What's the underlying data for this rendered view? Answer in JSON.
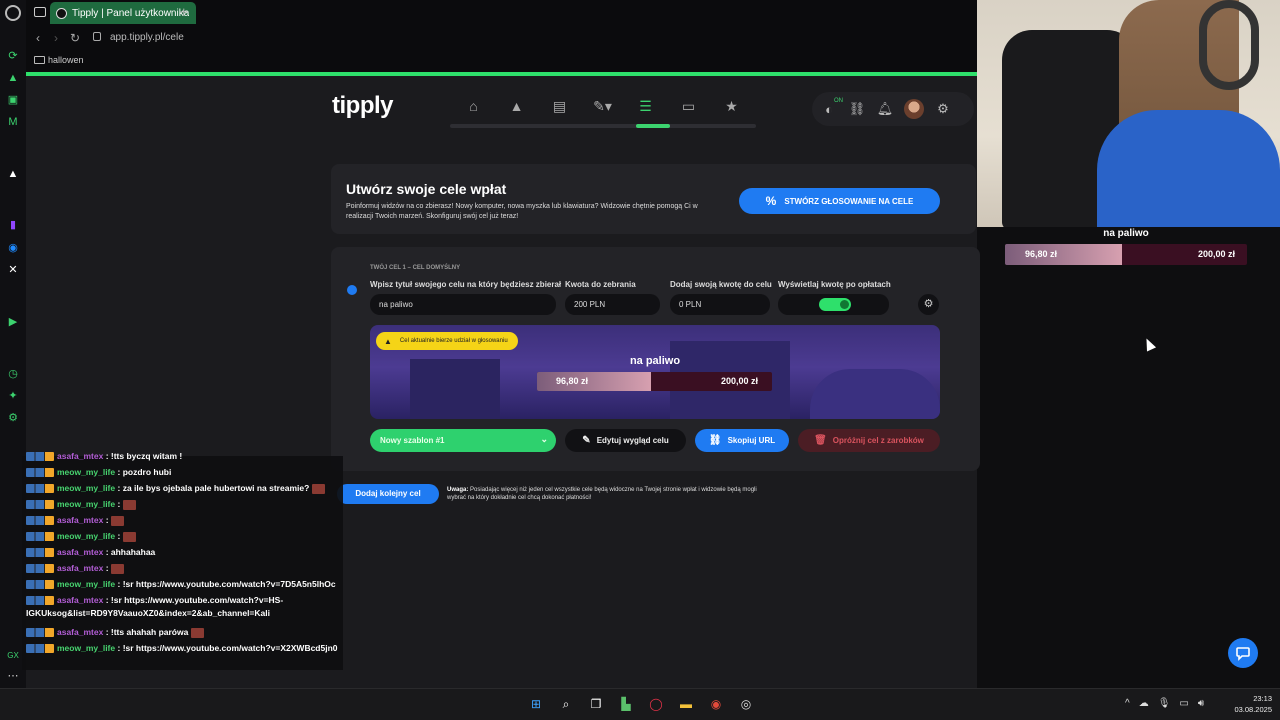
{
  "browser": {
    "tab_title": "Tipply | Panel użytkownika",
    "new_tab_symbol": "+",
    "url": "app.tipply.pl/cele",
    "bookmark": "hallowen"
  },
  "topnav": {
    "logo": "tipply",
    "on_badge": "ON"
  },
  "hero": {
    "title": "Utwórz swoje cele wpłat",
    "description": "Poinformuj widzów na co zbierasz! Nowy komputer, nowa myszka lub klawiatura? Widzowie chętnie pomogą Ci w realizacji Twoich marzeń. Skonfiguruj swój cel już teraz!",
    "button": "STWÓRZ GŁOSOWANIE NA CELE"
  },
  "goal": {
    "header": "TWÓJ CEL 1 – CEL DOMYŚLNY",
    "title_label": "Wpisz tytuł swojego celu na który będziesz zbierał",
    "title_value": "na paliwo",
    "amount_label": "Kwota do zebrania",
    "amount_value": "200 PLN",
    "own_label": "Dodaj swoją kwotę do celu",
    "own_value": "0 PLN",
    "show_label": "Wyświetlaj kwotę po opłatach",
    "toggle_on": true,
    "warning": "Cel aktualnie bierze udział w głosowaniu",
    "preview_title": "na paliwo",
    "current": "96,80 zł",
    "target": "200,00 zł",
    "progress_fraction": 0.484,
    "template_button": "Nowy szablon #1",
    "edit_button": "Edytuj wygląd celu",
    "copy_button": "Skopiuj URL",
    "clear_button": "Opróżnij cel z zarobków"
  },
  "add_goal_button": "Dodaj kolejny cel",
  "note": {
    "bold": "Uwaga:",
    "text": "Posiadając więcej niż jeden cel wszystkie cele będą widoczne na Twojej stronie wpłat i widzowie będą mogli wybrać na który dokładnie cel chcą dokonać płatności!"
  },
  "chat": [
    {
      "user": "asafa_mtex",
      "text": ": !tts byczq witam !",
      "cls": "u-asafa"
    },
    {
      "user": "meow_my_life",
      "text": ": pozdro hubi",
      "cls": "u-meow"
    },
    {
      "user": "meow_my_life",
      "text": ": za ile bys ojebala pale hubertowi na streamie?",
      "cls": "u-meow"
    },
    {
      "user": "meow_my_life",
      "text": ":",
      "cls": "u-meow"
    },
    {
      "user": "asafa_mtex",
      "text": ":",
      "cls": "u-asafa"
    },
    {
      "user": "meow_my_life",
      "text": ":",
      "cls": "u-meow"
    },
    {
      "user": "asafa_mtex",
      "text": ": ahhahahaa",
      "cls": "u-asafa"
    },
    {
      "user": "asafa_mtex",
      "text": ":",
      "cls": "u-asafa"
    },
    {
      "user": "meow_my_life",
      "text": ": !sr https://www.youtube.com/watch?v=7D5A5n5lhOc",
      "cls": "u-meow"
    },
    {
      "user": "asafa_mtex",
      "text": ": !sr https://www.youtube.com/watch?v=HS-IGKUksog&list=RD9Y8VaauoXZ0&index=2&ab_channel=Kali",
      "cls": "u-asafa"
    },
    {
      "user": "asafa_mtex",
      "text": ": !tts ahahah parówa",
      "cls": "u-asafa"
    },
    {
      "user": "meow_my_life",
      "text": ": !sr https://www.youtube.com/watch?v=X2XWBcd5jn0",
      "cls": "u-meow"
    }
  ],
  "stream_overlay": {
    "title": "na paliwo",
    "current": "96,80 zł",
    "target": "200,00 zł",
    "progress_fraction": 0.484
  },
  "taskbar": {
    "time": "23:13",
    "date": "03.08.2025"
  },
  "colors": {
    "accent_green": "#2ee06b",
    "accent_blue": "#1f7bf2",
    "warning_yellow": "#f5d417"
  }
}
